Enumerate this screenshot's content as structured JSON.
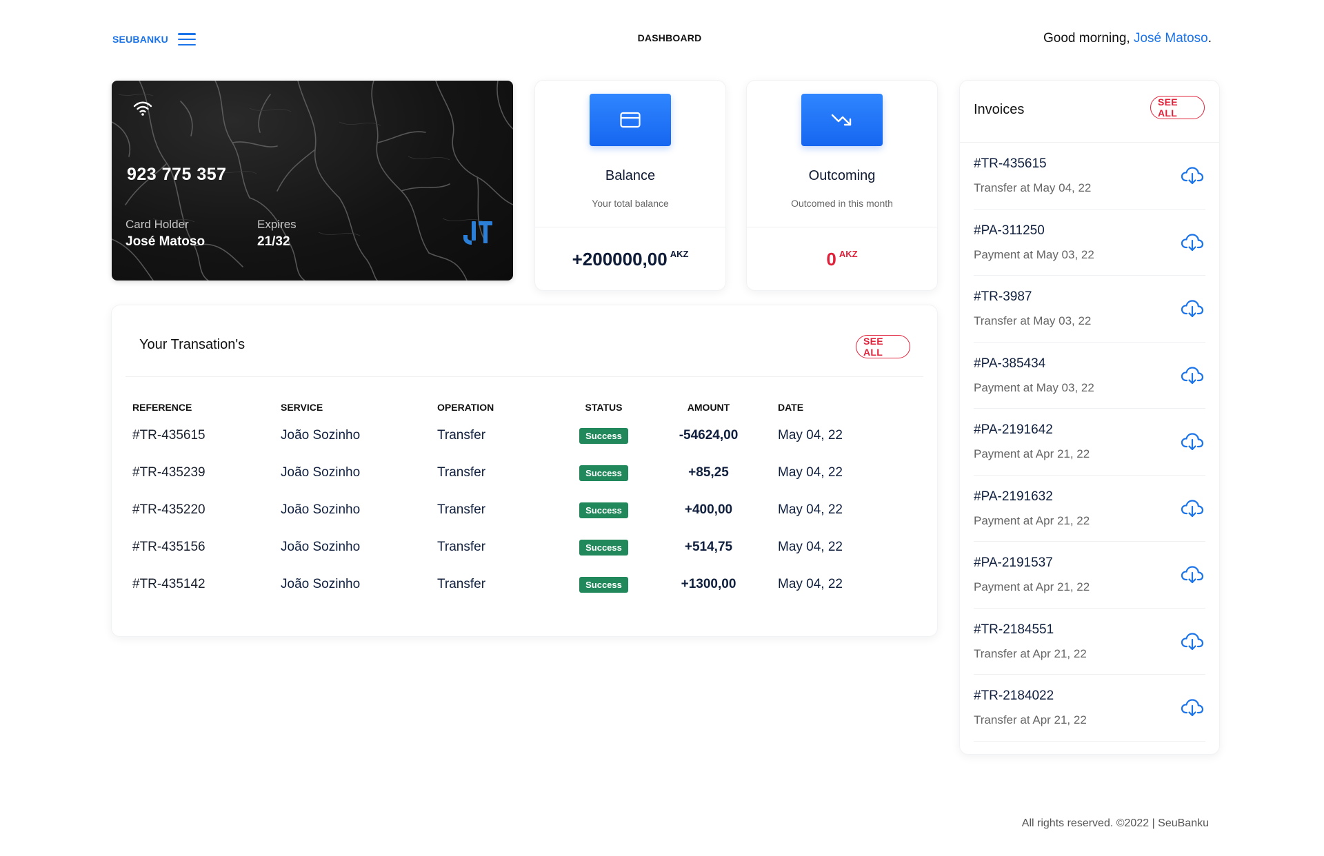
{
  "header": {
    "brand": "SEUBANKU",
    "title": "DASHBOARD",
    "greeting_prefix": "Good morning, ",
    "user_name": "José Matoso",
    "greeting_suffix": "."
  },
  "card": {
    "number": "923 775 357",
    "holder_label": "Card Holder",
    "holder_name": "José Matoso",
    "expires_label": "Expires",
    "expires": "21/32"
  },
  "stats": {
    "balance": {
      "icon": "credit-card-icon",
      "title": "Balance",
      "subtitle": "Your total balance",
      "value": "+200000,00",
      "currency": "AKZ"
    },
    "outcoming": {
      "icon": "trending-down-icon",
      "title": "Outcoming",
      "subtitle": "Outcomed in this month",
      "value": "0",
      "currency": "AKZ"
    }
  },
  "transactions": {
    "title": "Your Transation's",
    "see_all": "SEE ALL",
    "columns": [
      "REFERENCE",
      "SERVICE",
      "OPERATION",
      "STATUS",
      "AMOUNT",
      "DATE"
    ],
    "rows": [
      {
        "reference": "#TR-435615",
        "service": "João Sozinho",
        "operation": "Transfer",
        "status": "Success",
        "amount": "-54624,00",
        "date": "May 04, 22"
      },
      {
        "reference": "#TR-435239",
        "service": "João Sozinho",
        "operation": "Transfer",
        "status": "Success",
        "amount": "+85,25",
        "date": "May 04, 22"
      },
      {
        "reference": "#TR-435220",
        "service": "João Sozinho",
        "operation": "Transfer",
        "status": "Success",
        "amount": "+400,00",
        "date": "May 04, 22"
      },
      {
        "reference": "#TR-435156",
        "service": "João Sozinho",
        "operation": "Transfer",
        "status": "Success",
        "amount": "+514,75",
        "date": "May 04, 22"
      },
      {
        "reference": "#TR-435142",
        "service": "João Sozinho",
        "operation": "Transfer",
        "status": "Success",
        "amount": "+1300,00",
        "date": "May 04, 22"
      }
    ]
  },
  "invoices": {
    "title": "Invoices",
    "see_all": "SEE ALL",
    "items": [
      {
        "ref": "#TR-435615",
        "desc": "Transfer at May 04, 22"
      },
      {
        "ref": "#PA-311250",
        "desc": "Payment at May 03, 22"
      },
      {
        "ref": "#TR-3987",
        "desc": "Transfer at May 03, 22"
      },
      {
        "ref": "#PA-385434",
        "desc": "Payment at May 03, 22"
      },
      {
        "ref": "#PA-2191642",
        "desc": "Payment at Apr 21, 22"
      },
      {
        "ref": "#PA-2191632",
        "desc": "Payment at Apr 21, 22"
      },
      {
        "ref": "#PA-2191537",
        "desc": "Payment at Apr 21, 22"
      },
      {
        "ref": "#TR-2184551",
        "desc": "Transfer at Apr 21, 22"
      },
      {
        "ref": "#TR-2184022",
        "desc": "Transfer at Apr 21, 22"
      }
    ]
  },
  "footer": {
    "text": "All rights reserved. ©2022 | SeuBanku"
  },
  "colors": {
    "accent": "#1a73e8",
    "danger": "#e0213a",
    "success": "#20885a",
    "positive_amount": "#1f8a4c"
  }
}
